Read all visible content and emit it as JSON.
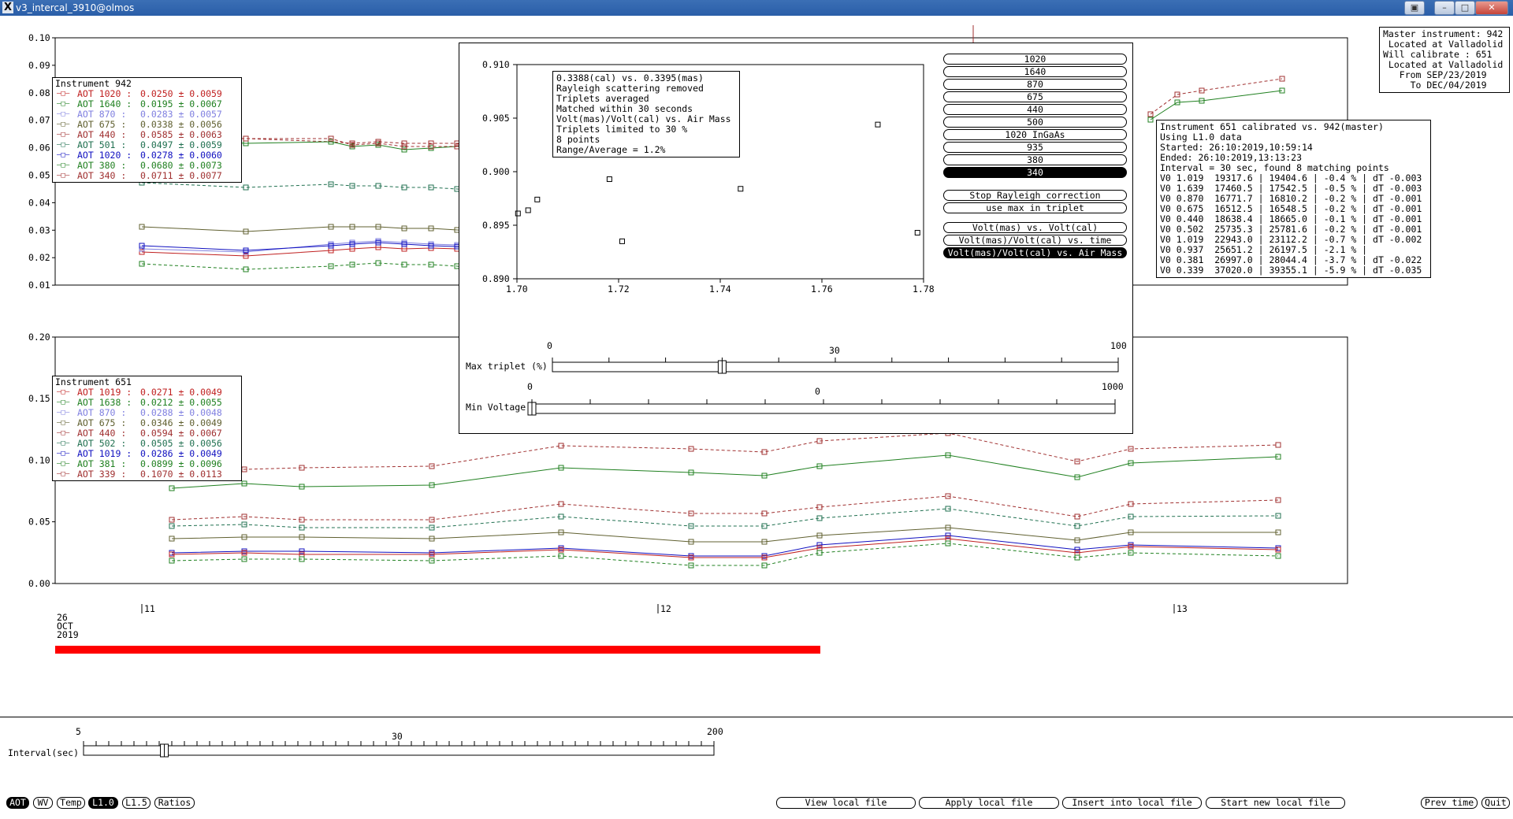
{
  "window": {
    "title": "v3_intercal_3910@olmos",
    "x_icon": "X"
  },
  "top_plot": {
    "y_ticks": [
      "0.10",
      "0.09",
      "0.08",
      "0.07",
      "0.06",
      "0.05",
      "0.04",
      "0.03",
      "0.02",
      "0.01"
    ],
    "legend_title": "Instrument 942",
    "legend": [
      {
        "label": "AOT 1020 :",
        "value": "0.0250 ± 0.0059",
        "color": "#c02020"
      },
      {
        "label": "AOT 1640 :",
        "value": "0.0195 ± 0.0067",
        "color": "#208020"
      },
      {
        "label": "AOT 870 :",
        "value": "0.0283 ± 0.0057",
        "color": "#8080e0"
      },
      {
        "label": "AOT 675 :",
        "value": "0.0338 ± 0.0056",
        "color": "#606030"
      },
      {
        "label": "AOT 440 :",
        "value": "0.0585 ± 0.0063",
        "color": "#a03030"
      },
      {
        "label": "AOT 501 :",
        "value": "0.0497 ± 0.0059",
        "color": "#207050"
      },
      {
        "label": "AOT 1020 :",
        "value": "0.0278 ± 0.0060",
        "color": "#1010c0"
      },
      {
        "label": "AOT 380 :",
        "value": "0.0680 ± 0.0073",
        "color": "#208020"
      },
      {
        "label": "AOT 340 :",
        "value": "0.0711 ± 0.0077",
        "color": "#a03030"
      }
    ]
  },
  "bottom_plot": {
    "y_ticks": [
      "0.20",
      "0.15",
      "0.10",
      "0.05",
      "0.00"
    ],
    "legend_title": "Instrument 651",
    "legend": [
      {
        "label": "AOT 1019 :",
        "value": "0.0271 ± 0.0049",
        "color": "#c02020"
      },
      {
        "label": "AOT 1638 :",
        "value": "0.0212 ± 0.0055",
        "color": "#208020"
      },
      {
        "label": "AOT 870 :",
        "value": "0.0288 ± 0.0048",
        "color": "#8080e0"
      },
      {
        "label": "AOT 675 :",
        "value": "0.0346 ± 0.0049",
        "color": "#606030"
      },
      {
        "label": "AOT 440 :",
        "value": "0.0594 ± 0.0067",
        "color": "#a03030"
      },
      {
        "label": "AOT 502 :",
        "value": "0.0505 ± 0.0056",
        "color": "#207050"
      },
      {
        "label": "AOT 1019 :",
        "value": "0.0286 ± 0.0049",
        "color": "#1010c0"
      },
      {
        "label": "AOT 381 :",
        "value": "0.0899 ± 0.0096",
        "color": "#208020"
      },
      {
        "label": "AOT 339 :",
        "value": "0.1070 ± 0.0113",
        "color": "#a03030"
      }
    ],
    "x_ticks": [
      "11",
      "12",
      "13"
    ],
    "date_lines": [
      "26",
      "OCT",
      "2019"
    ]
  },
  "master_box": [
    "Master instrument: 942",
    " Located at Valladolid",
    "Will calibrate : 651",
    " Located at Valladolid",
    "   From SEP/23/2019",
    "     To DEC/04/2019"
  ],
  "calib_box": [
    "Instrument 651 calibrated vs. 942(master)",
    "Using L1.0 data",
    "Started: 26:10:2019,10:59:14",
    "Ended: 26:10:2019,13:13:23",
    "Interval = 30 sec, found 8 matching points",
    "V0 1.019  19317.6 | 19404.6 | -0.4 % | dT -0.003",
    "V0 1.639  17460.5 | 17542.5 | -0.5 % | dT -0.003",
    "V0 0.870  16771.7 | 16810.2 | -0.2 % | dT -0.001",
    "V0 0.675  16512.5 | 16548.5 | -0.2 % | dT -0.001",
    "V0 0.440  18638.4 | 18665.0 | -0.1 % | dT -0.001",
    "V0 0.502  25735.3 | 25781.6 | -0.2 % | dT -0.001",
    "V0 1.019  22943.0 | 23112.2 | -0.7 % | dT -0.002",
    "V0 0.937  25651.2 | 26197.5 | -2.1 % |",
    "V0 0.381  26997.0 | 28044.4 | -3.7 % | dT -0.022",
    "V0 0.339  37020.0 | 39355.1 | -5.9 % | dT -0.035"
  ],
  "popup": {
    "info_box": [
      "0.3388(cal) vs. 0.3395(mas)",
      "Rayleigh scattering removed",
      "Triplets averaged",
      "Matched within 30 seconds",
      "Volt(mas)/Volt(cal) vs. Air Mass",
      "Triplets limited to 30 %",
      "8 points",
      "Range/Average = 1.2%"
    ],
    "wavelength_buttons": [
      "1020",
      "1640",
      "870",
      "675",
      "440",
      "500",
      "1020 InGaAs",
      "935",
      "380",
      "340"
    ],
    "selected_wavelength": "340",
    "option_buttons": [
      "Stop Rayleigh correction",
      "use max in triplet"
    ],
    "plot_mode_buttons": [
      "Volt(mas) vs. Volt(cal)",
      "Volt(mas)/Volt(cal) vs. time",
      "Volt(mas)/Volt(cal) vs. Air Mass"
    ],
    "selected_mode": "Volt(mas)/Volt(cal) vs. Air Mass",
    "max_triplet": {
      "label": "Max triplet (%)",
      "min": "0",
      "mid": "30",
      "max": "100",
      "value": 30
    },
    "min_voltage": {
      "label": "Min Voltage",
      "min": "0",
      "mid": "0",
      "max": "1000",
      "value": 0
    }
  },
  "chart_data": {
    "type": "scatter",
    "title": "",
    "xlabel": "",
    "ylabel": "",
    "xlim": [
      1.7,
      1.78
    ],
    "ylim": [
      0.89,
      0.91
    ],
    "x_ticks": [
      "1.70",
      "1.72",
      "1.74",
      "1.76",
      "1.78"
    ],
    "y_ticks": [
      "0.910",
      "0.905",
      "0.900",
      "0.895",
      "0.890"
    ],
    "points": [
      {
        "x": 1.7002,
        "y": 0.8961
      },
      {
        "x": 1.7022,
        "y": 0.8964
      },
      {
        "x": 1.704,
        "y": 0.8974
      },
      {
        "x": 1.7182,
        "y": 0.8993
      },
      {
        "x": 1.7207,
        "y": 0.8935
      },
      {
        "x": 1.744,
        "y": 0.8984
      },
      {
        "x": 1.771,
        "y": 0.9044
      },
      {
        "x": 1.7788,
        "y": 0.8943
      }
    ]
  },
  "interval": {
    "label": "Interval(sec)",
    "min": "5",
    "mid": "30",
    "max": "200",
    "value": 30
  },
  "bottom_bar": {
    "left_buttons": [
      "AOT",
      "WV",
      "Temp",
      "L1.0",
      "L1.5",
      "Ratios"
    ],
    "selected_left": [
      "AOT",
      "L1.0"
    ],
    "file_buttons": [
      "View local file",
      "Apply local file",
      "Insert into local file",
      "Start new local file"
    ],
    "right_buttons": [
      "Prev time",
      "Quit"
    ]
  },
  "colors": {
    "progress_bar": "#ff0000",
    "titlebar": "#2a5ea8"
  },
  "icons": [
    "x-window-icon",
    "minimize-icon",
    "maximize-icon",
    "close-icon",
    "restore-icon"
  ]
}
